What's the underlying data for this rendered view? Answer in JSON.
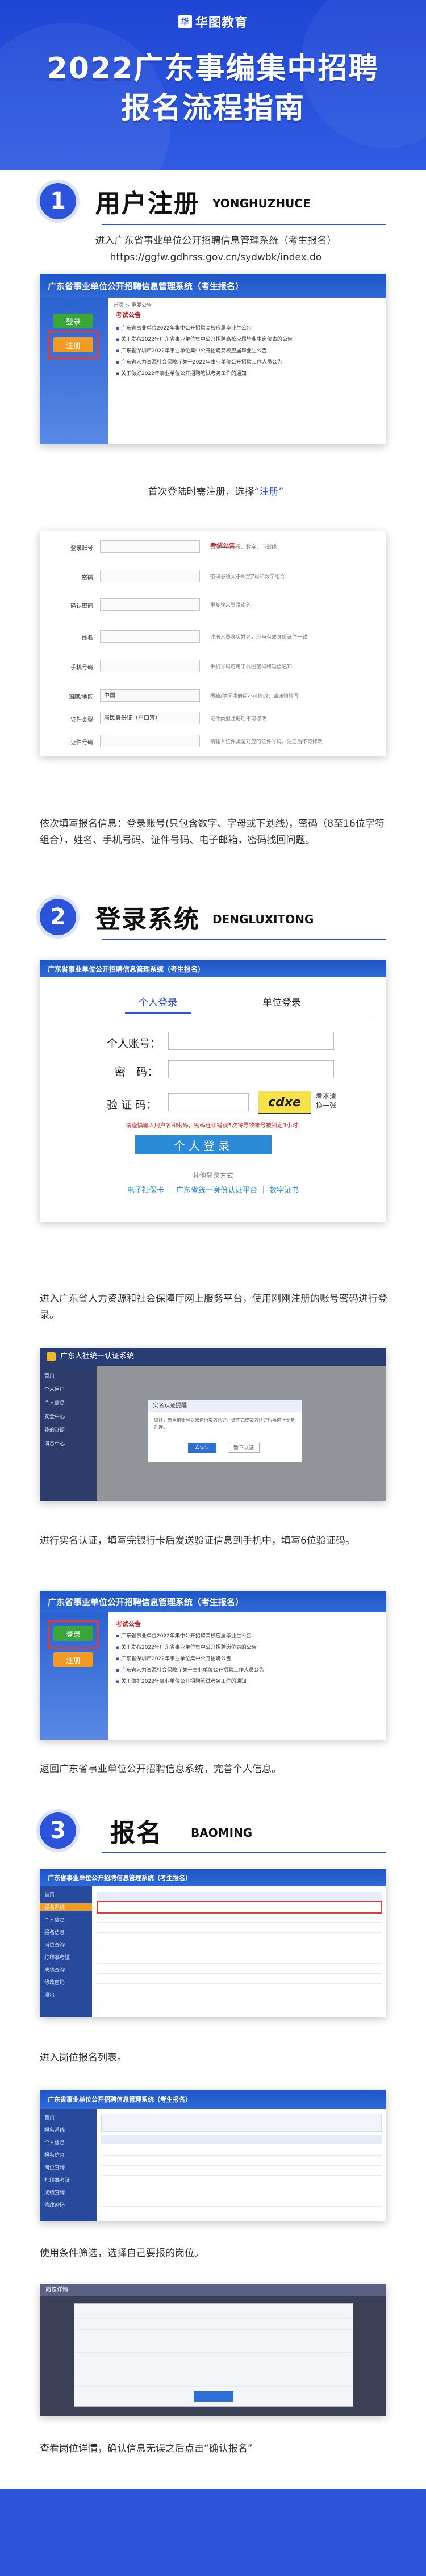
{
  "brand": {
    "logo_mark": "华",
    "logo_text": "华图教育"
  },
  "title": {
    "line1": "2022广东事编集中招聘",
    "line2": "报名流程指南"
  },
  "section1": {
    "num": "1",
    "title": "用户注册",
    "sub": "YONGHUZHUCE",
    "intro_line1": "进入广东省事业单位公开招聘信息管理系统（考生报名）",
    "intro_line2": "https://ggfw.gdhrss.gov.cn/sydwbk/index.do",
    "shot1": {
      "sysbar": "广东省事业单位公开招聘信息管理系统（考生报名）",
      "breadcrumb": "首页 > 重要公告",
      "green_btn": "登录",
      "orange_btn": "注册",
      "notice_title": "考试公告",
      "notices": [
        "广东省事业单位2022年集中公开招聘高校应届毕业生公告",
        "关于发布2022年广东省事业单位集中公开招聘高校应届毕业生岗位表的公告",
        "广东省深圳市2022年事业单位集中公开招聘高校应届毕业生公告",
        "广东省人力资源社会保障厅关于2022年事业单位公开招聘工作人员公告",
        "关于做好2022年事业单位公开招聘笔试考务工作的通知"
      ]
    },
    "caption_a_pre": "首次登陆时需注册，选择",
    "caption_a_key": "“注册”",
    "form": {
      "notice_title": "考试公告",
      "rows": [
        {
          "label": "登录账号",
          "value": "",
          "hint": "只能包含字母、数字、下划线"
        },
        {
          "label": "密码",
          "value": "",
          "hint": "密码必须大于8位字母和数字组合"
        },
        {
          "label": "确认密码",
          "value": "",
          "hint": "重复输入登录密码"
        },
        {
          "label": "姓名",
          "value": "",
          "hint": "注册人员真实姓名，应与有效身份证件一致"
        },
        {
          "label": "手机号码",
          "value": "",
          "hint": "手机号码可用于找回密码和短信通知"
        },
        {
          "label": "国籍/地区",
          "value": "中国",
          "hint": "国籍/地区注册后不可修改，请谨慎填写"
        },
        {
          "label": "证件类型",
          "value": "居民身份证（户口簿）",
          "hint": "证件类型注册后不可修改"
        },
        {
          "label": "证件号码",
          "value": "",
          "hint": "请输入证件类型对应的证件号码，注册后不可修改"
        }
      ]
    },
    "caption_b": "依次填写报名信息：登录账号(只包含数字、字母或下划线)，密码（8至16位字符组合），姓名、手机号码、证件号码、电子邮箱，密码找回问题。"
  },
  "section2": {
    "num": "2",
    "title": "登录系统",
    "sub": "DENGLUXITONG",
    "login": {
      "sysbar": "广东省事业单位公开招聘信息管理系统（考生报名）",
      "tab_person": "个人登录",
      "tab_unit": "单位登录",
      "label_account": "个人账号：",
      "label_password": "密　码：",
      "label_captcha": "验 证 码：",
      "captcha_text": "cdxe",
      "captcha_refresh": "看不清\n换一张",
      "warning": "请谨慎输入用户名和密码，密码连续错误5次将导致帐号被锁定3小时!",
      "login_btn": "个人登录",
      "other_title": "其他登录方式",
      "other_links": [
        "电子社保卡",
        "广东省统一身份认证平台",
        "数字证书"
      ]
    },
    "caption_c": "进入广东省人力资源和社会保障厅网上服务平台，使用刚刚注册的账号密码进行登录。",
    "shot3": {
      "topbar": "广东人社统一认证系统",
      "dialog_title": "实名认证提醒",
      "dialog_text": "您好，您当前账号尚未进行实名认证，请先完成实名认证后再进行业务办理。",
      "btn_ok": "去认证",
      "btn_cancel": "暂不认证",
      "nav": [
        "首页",
        "个人用户",
        "个人信息",
        "安全中心",
        "我的证照",
        "消息中心"
      ]
    },
    "caption_d": "进行实名认证，填写完银行卡后发送验证信息到手机中，填写6位验证码。",
    "shot4": {
      "sysbar": "广东省事业单位公开招聘信息管理系统（考生报名）",
      "green_btn": "登录",
      "orange_btn": "注册",
      "notice_title": "考试公告",
      "notices": [
        "广东省事业单位2022年集中公开招聘高校应届毕业生公告",
        "关于发布2022年广东省事业单位集中公开招聘岗位表的公告",
        "广东省深圳市2022年事业单位集中公开招聘公告",
        "广东省人力资源社会保障厅关于事业单位公开招聘工作人员公告",
        "关于做好2022年事业单位公开招聘笔试考务工作的通知"
      ]
    },
    "caption_e": "返回广东省事业单位公开招聘信息系统，完善个人信息。"
  },
  "section3": {
    "num": "3",
    "title": "报名",
    "sub": "BAOMING",
    "shot5": {
      "sysbar": "广东省事业单位公开招聘信息管理系统（考生报名）",
      "nav": [
        "首页",
        "报名系统",
        "个人信息",
        "报名信息",
        "岗位查询",
        "打印准考证",
        "成绩查询",
        "修改密码",
        "退出"
      ]
    },
    "caption_f": "进入岗位报名列表。",
    "shot6": {
      "sysbar": "广东省事业单位公开招聘信息管理系统（考生报名）",
      "nav": [
        "首页",
        "报名系统",
        "个人信息",
        "报名信息",
        "岗位查询",
        "打印准考证",
        "成绩查询",
        "修改密码"
      ]
    },
    "caption_g": "使用条件筛选，选择自己要报的岗位。",
    "shot7": {
      "header": "岗位详情"
    },
    "caption_h_pre": "查看岗位详情，确认信息无误之后点击",
    "caption_h_key": "“确认报名”"
  }
}
